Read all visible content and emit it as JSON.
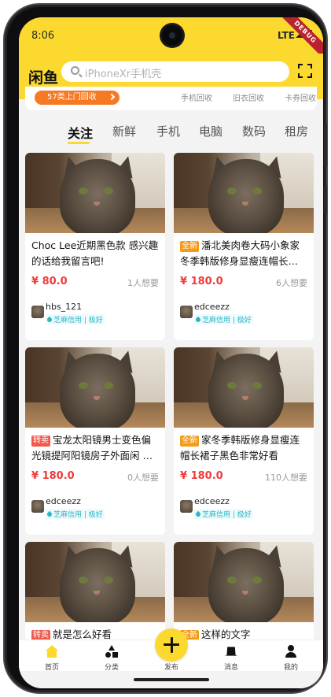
{
  "status_bar": {
    "time": "8:06",
    "network": "LTE",
    "debug_label": "DEBUG"
  },
  "header": {
    "logo": "闲鱼",
    "search_placeholder": "iPhoneXr手机壳"
  },
  "recycle": {
    "pill_label": "57类上门回收",
    "links": [
      "手机回收",
      "旧衣回收",
      "卡券回收"
    ]
  },
  "tabs": [
    "关注",
    "新鲜",
    "手机",
    "电脑",
    "数码",
    "租房"
  ],
  "active_tab": "关注",
  "products": [
    {
      "tag": "",
      "title": " Choc Lee近期黑色款 感兴趣的话给我留言吧!",
      "price": "¥ 80.0",
      "want": "1人想要",
      "user": "hbs_121",
      "credit": "芝麻信用 | 极好"
    },
    {
      "tag": "全新",
      "tag_type": "new",
      "title": "潘北美肉卷大码小象家冬季韩版修身显瘦连帽长…",
      "price": "¥ 180.0",
      "want": "6人想要",
      "user": "edceezz",
      "credit": "芝麻信用 | 极好"
    },
    {
      "tag": "转卖",
      "tag_type": "resale",
      "title": "宝龙太阳镜男士变色偏光镜提阿阳镜房子外面闲 …",
      "price": "¥ 180.0",
      "want": "0人想要",
      "user": "edceezz",
      "credit": "芝麻信用 | 极好"
    },
    {
      "tag": "全新",
      "tag_type": "new",
      "title": "家冬季韩版修身显瘦连帽长裙子黑色非常好看",
      "price": "¥ 180.0",
      "want": "110人想要",
      "user": "edceezz",
      "credit": "芝麻信用 | 极好"
    },
    {
      "tag": "转卖",
      "tag_type": "resale",
      "title": "就是怎么好看",
      "price": "",
      "want": "",
      "user": "",
      "credit": ""
    },
    {
      "tag": "全新",
      "tag_type": "new",
      "title": "这样的文字",
      "price": "",
      "want": "",
      "user": "",
      "credit": ""
    }
  ],
  "bottom_nav": {
    "home": "首页",
    "category": "分类",
    "publish": "发布",
    "messages": "消息",
    "me": "我的"
  },
  "colors": {
    "brand_yellow": "#fcd92e",
    "price_red": "#ef3b3b",
    "credit_teal": "#2bb7c6"
  }
}
